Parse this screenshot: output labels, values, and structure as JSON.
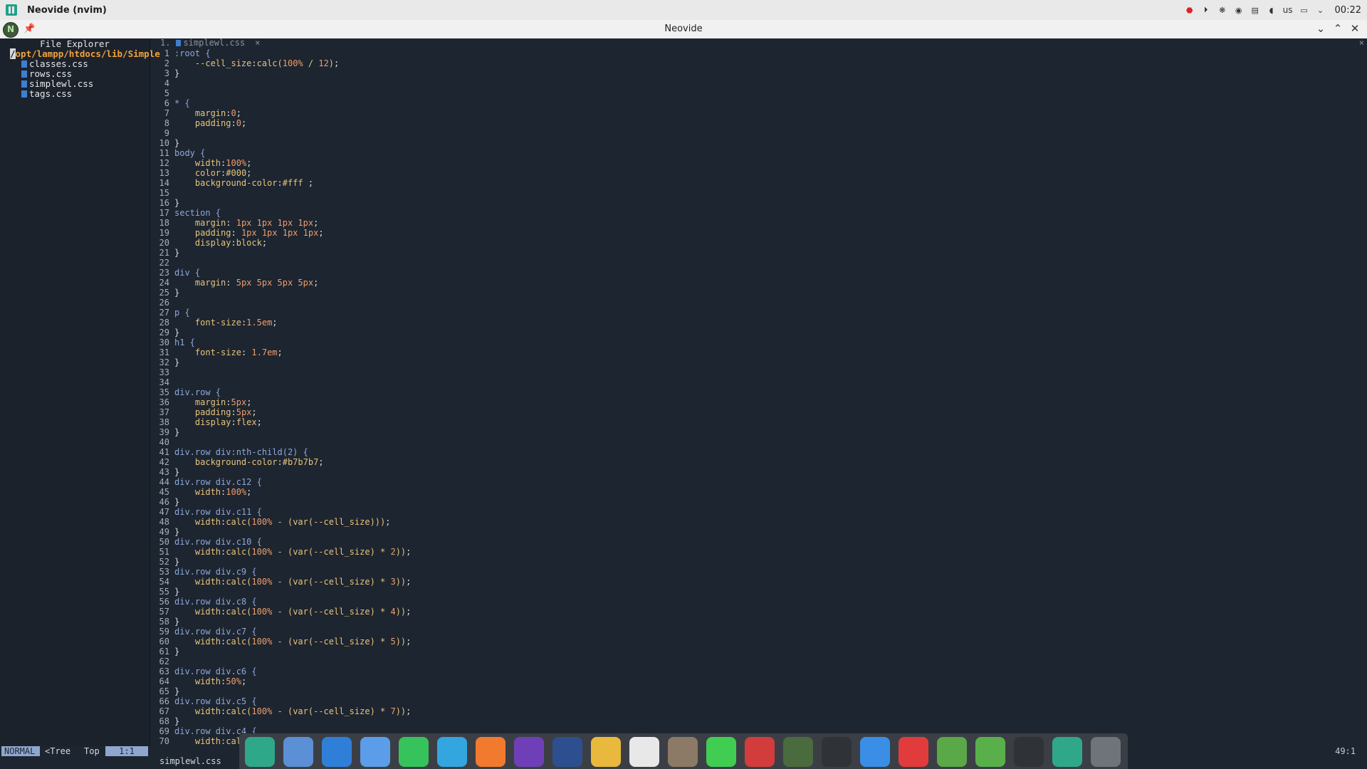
{
  "system_bar": {
    "app_title": "Neovide (nvim)",
    "keyboard_layout": "us",
    "clock": "00:22"
  },
  "window": {
    "title": "Neovide",
    "pin_glyph": "📌",
    "collapse_glyph": "⌄",
    "restore_glyph": "⌃",
    "close_glyph": "✕"
  },
  "tree": {
    "header": "File Explorer",
    "root_cursor": "/",
    "root_rest": "opt/lampp/htdocs/lib/Simple",
    "files": [
      "classes.css",
      "rows.css",
      "simplewl.css",
      "tags.css"
    ]
  },
  "tabline": {
    "number": "1.",
    "name": "simplewl.css",
    "close": "×",
    "far_close": "×"
  },
  "code_lines": [
    [
      [
        "sel",
        ":root {"
      ]
    ],
    [
      [
        "plain",
        "    "
      ],
      [
        "prop",
        "--cell_size"
      ],
      [
        "plain",
        ":"
      ],
      [
        "val",
        "calc("
      ],
      [
        "num2",
        "100%"
      ],
      [
        "val",
        " / "
      ],
      [
        "num2",
        "12"
      ],
      [
        "val",
        ")"
      ],
      [
        "plain",
        ";"
      ]
    ],
    [
      [
        "plain",
        "}"
      ]
    ],
    [],
    [],
    [
      [
        "sel",
        "* {"
      ]
    ],
    [
      [
        "plain",
        "    "
      ],
      [
        "prop",
        "margin"
      ],
      [
        "plain",
        ":"
      ],
      [
        "num2",
        "0"
      ],
      [
        "plain",
        ";"
      ]
    ],
    [
      [
        "plain",
        "    "
      ],
      [
        "prop",
        "padding"
      ],
      [
        "plain",
        ":"
      ],
      [
        "num2",
        "0"
      ],
      [
        "plain",
        ";"
      ]
    ],
    [],
    [
      [
        "plain",
        "}"
      ]
    ],
    [
      [
        "sel",
        "body {"
      ]
    ],
    [
      [
        "plain",
        "    "
      ],
      [
        "prop",
        "width"
      ],
      [
        "plain",
        ":"
      ],
      [
        "num2",
        "100%"
      ],
      [
        "plain",
        ";"
      ]
    ],
    [
      [
        "plain",
        "    "
      ],
      [
        "prop",
        "color"
      ],
      [
        "plain",
        ":"
      ],
      [
        "val",
        "#000"
      ],
      [
        "plain",
        ";"
      ]
    ],
    [
      [
        "plain",
        "    "
      ],
      [
        "prop",
        "background-color"
      ],
      [
        "plain",
        ":"
      ],
      [
        "val",
        "#fff"
      ],
      [
        "plain",
        " ;"
      ]
    ],
    [],
    [
      [
        "plain",
        "}"
      ]
    ],
    [
      [
        "sel",
        "section {"
      ]
    ],
    [
      [
        "plain",
        "    "
      ],
      [
        "prop",
        "margin"
      ],
      [
        "plain",
        ": "
      ],
      [
        "num2",
        "1px 1px 1px 1px"
      ],
      [
        "plain",
        ";"
      ]
    ],
    [
      [
        "plain",
        "    "
      ],
      [
        "prop",
        "padding"
      ],
      [
        "plain",
        ": "
      ],
      [
        "num2",
        "1px 1px 1px 1px"
      ],
      [
        "plain",
        ";"
      ]
    ],
    [
      [
        "plain",
        "    "
      ],
      [
        "prop",
        "display"
      ],
      [
        "plain",
        ":"
      ],
      [
        "val",
        "block"
      ],
      [
        "plain",
        ";"
      ]
    ],
    [
      [
        "plain",
        "}"
      ]
    ],
    [],
    [
      [
        "sel",
        "div {"
      ]
    ],
    [
      [
        "plain",
        "    "
      ],
      [
        "prop",
        "margin"
      ],
      [
        "plain",
        ": "
      ],
      [
        "num2",
        "5px 5px 5px 5px"
      ],
      [
        "plain",
        ";"
      ]
    ],
    [
      [
        "plain",
        "}"
      ]
    ],
    [],
    [
      [
        "sel",
        "p {"
      ]
    ],
    [
      [
        "plain",
        "    "
      ],
      [
        "prop",
        "font-size"
      ],
      [
        "plain",
        ":"
      ],
      [
        "num2",
        "1.5em"
      ],
      [
        "plain",
        ";"
      ]
    ],
    [
      [
        "plain",
        "}"
      ]
    ],
    [
      [
        "sel",
        "h1 {"
      ]
    ],
    [
      [
        "plain",
        "    "
      ],
      [
        "prop",
        "font-size"
      ],
      [
        "plain",
        ": "
      ],
      [
        "num2",
        "1.7em"
      ],
      [
        "plain",
        ";"
      ]
    ],
    [
      [
        "plain",
        "}"
      ]
    ],
    [],
    [],
    [
      [
        "sel",
        "div.row {"
      ]
    ],
    [
      [
        "plain",
        "    "
      ],
      [
        "prop",
        "margin"
      ],
      [
        "plain",
        ":"
      ],
      [
        "num2",
        "5px"
      ],
      [
        "plain",
        ";"
      ]
    ],
    [
      [
        "plain",
        "    "
      ],
      [
        "prop",
        "padding"
      ],
      [
        "plain",
        ":"
      ],
      [
        "num2",
        "5px"
      ],
      [
        "plain",
        ";"
      ]
    ],
    [
      [
        "plain",
        "    "
      ],
      [
        "prop",
        "display"
      ],
      [
        "plain",
        ":"
      ],
      [
        "val",
        "flex"
      ],
      [
        "plain",
        ";"
      ]
    ],
    [
      [
        "plain",
        "}"
      ]
    ],
    [],
    [
      [
        "sel",
        "div.row div:nth-child(2) {"
      ]
    ],
    [
      [
        "plain",
        "    "
      ],
      [
        "prop",
        "background-color"
      ],
      [
        "plain",
        ":"
      ],
      [
        "val",
        "#b7b7b7"
      ],
      [
        "plain",
        ";"
      ]
    ],
    [
      [
        "plain",
        "}"
      ]
    ],
    [
      [
        "sel",
        "div.row div.c12 {"
      ]
    ],
    [
      [
        "plain",
        "    "
      ],
      [
        "prop",
        "width"
      ],
      [
        "plain",
        ":"
      ],
      [
        "num2",
        "100%"
      ],
      [
        "plain",
        ";"
      ]
    ],
    [
      [
        "plain",
        "}"
      ]
    ],
    [
      [
        "sel",
        "div.row div.c11 {"
      ]
    ],
    [
      [
        "plain",
        "    "
      ],
      [
        "prop",
        "width"
      ],
      [
        "plain",
        ":"
      ],
      [
        "val",
        "calc("
      ],
      [
        "num2",
        "100%"
      ],
      [
        "val",
        " - (var(--cell_size)))"
      ],
      [
        "plain",
        ";"
      ]
    ],
    [
      [
        "plain",
        "}"
      ]
    ],
    [
      [
        "sel",
        "div.row div.c10 {"
      ]
    ],
    [
      [
        "plain",
        "    "
      ],
      [
        "prop",
        "width"
      ],
      [
        "plain",
        ":"
      ],
      [
        "val",
        "calc("
      ],
      [
        "num2",
        "100%"
      ],
      [
        "val",
        " - (var(--cell_size) * "
      ],
      [
        "num2",
        "2"
      ],
      [
        "val",
        "))"
      ],
      [
        "plain",
        ";"
      ]
    ],
    [
      [
        "plain",
        "}"
      ]
    ],
    [
      [
        "sel",
        "div.row div.c9 {"
      ]
    ],
    [
      [
        "plain",
        "    "
      ],
      [
        "prop",
        "width"
      ],
      [
        "plain",
        ":"
      ],
      [
        "val",
        "calc("
      ],
      [
        "num2",
        "100%"
      ],
      [
        "val",
        " - (var(--cell_size) * "
      ],
      [
        "num2",
        "3"
      ],
      [
        "val",
        "))"
      ],
      [
        "plain",
        ";"
      ]
    ],
    [
      [
        "plain",
        "}"
      ]
    ],
    [
      [
        "sel",
        "div.row div.c8 {"
      ]
    ],
    [
      [
        "plain",
        "    "
      ],
      [
        "prop",
        "width"
      ],
      [
        "plain",
        ":"
      ],
      [
        "val",
        "calc("
      ],
      [
        "num2",
        "100%"
      ],
      [
        "val",
        " - (var(--cell_size) * "
      ],
      [
        "num2",
        "4"
      ],
      [
        "val",
        "))"
      ],
      [
        "plain",
        ";"
      ]
    ],
    [
      [
        "plain",
        "}"
      ]
    ],
    [
      [
        "sel",
        "div.row div.c7 {"
      ]
    ],
    [
      [
        "plain",
        "    "
      ],
      [
        "prop",
        "width"
      ],
      [
        "plain",
        ":"
      ],
      [
        "val",
        "calc("
      ],
      [
        "num2",
        "100%"
      ],
      [
        "val",
        " - (var(--cell_size) * "
      ],
      [
        "num2",
        "5"
      ],
      [
        "val",
        "))"
      ],
      [
        "plain",
        ";"
      ]
    ],
    [
      [
        "plain",
        "}"
      ]
    ],
    [],
    [
      [
        "sel",
        "div.row div.c6 {"
      ]
    ],
    [
      [
        "plain",
        "    "
      ],
      [
        "prop",
        "width"
      ],
      [
        "plain",
        ":"
      ],
      [
        "num2",
        "50%"
      ],
      [
        "plain",
        ";"
      ]
    ],
    [
      [
        "plain",
        "}"
      ]
    ],
    [
      [
        "sel",
        "div.row div.c5 {"
      ]
    ],
    [
      [
        "plain",
        "    "
      ],
      [
        "prop",
        "width"
      ],
      [
        "plain",
        ":"
      ],
      [
        "val",
        "calc("
      ],
      [
        "num2",
        "100%"
      ],
      [
        "val",
        " - (var(--cell_size) * "
      ],
      [
        "num2",
        "7"
      ],
      [
        "val",
        "))"
      ],
      [
        "plain",
        ";"
      ]
    ],
    [
      [
        "plain",
        "}"
      ]
    ],
    [
      [
        "sel",
        "div.row div.c4 {"
      ]
    ],
    [
      [
        "plain",
        "    "
      ],
      [
        "prop",
        "width:cal"
      ]
    ]
  ],
  "status": {
    "mode": "NORMAL",
    "buffer": "<Tree",
    "scroll": "Top",
    "position": "1:1",
    "cursor_pos": "49:1",
    "cmdline": "simplewl.css"
  },
  "dock_icons": [
    {
      "name": "files-icon",
      "color": "#2fa889"
    },
    {
      "name": "file-manager-icon",
      "color": "#5b8fd6"
    },
    {
      "name": "windows-apps-icon",
      "color": "#2f7fd9"
    },
    {
      "name": "mail-icon",
      "color": "#5b9de8"
    },
    {
      "name": "whatsapp-icon",
      "color": "#36c35b"
    },
    {
      "name": "telegram-icon",
      "color": "#33a6e0"
    },
    {
      "name": "firefox-icon",
      "color": "#f27a2e"
    },
    {
      "name": "podcast-icon",
      "color": "#6f3fb8"
    },
    {
      "name": "cloud-icon",
      "color": "#2d4f8f"
    },
    {
      "name": "chrome-icon",
      "color": "#e9b93d"
    },
    {
      "name": "yinyang-icon",
      "color": "#e8e8e8"
    },
    {
      "name": "gimp-icon",
      "color": "#8c7a66"
    },
    {
      "name": "qc-icon",
      "color": "#41cd52"
    },
    {
      "name": "cherry-icon",
      "color": "#d23c3c"
    },
    {
      "name": "neovim-icon",
      "color": "#4a6b3e"
    },
    {
      "name": "terminal-icon",
      "color": "#2f3338"
    },
    {
      "name": "document-icon",
      "color": "#3a8ee6"
    },
    {
      "name": "git-icon",
      "color": "#e23b3b"
    },
    {
      "name": "keepass-icon",
      "color": "#5aa847"
    },
    {
      "name": "download-icon",
      "color": "#59b04a"
    },
    {
      "name": "apps-grid-icon",
      "color": "#2f3338"
    },
    {
      "name": "workspace-icon",
      "color": "#2fa889"
    },
    {
      "name": "trash-icon",
      "color": "#6f747b"
    }
  ]
}
